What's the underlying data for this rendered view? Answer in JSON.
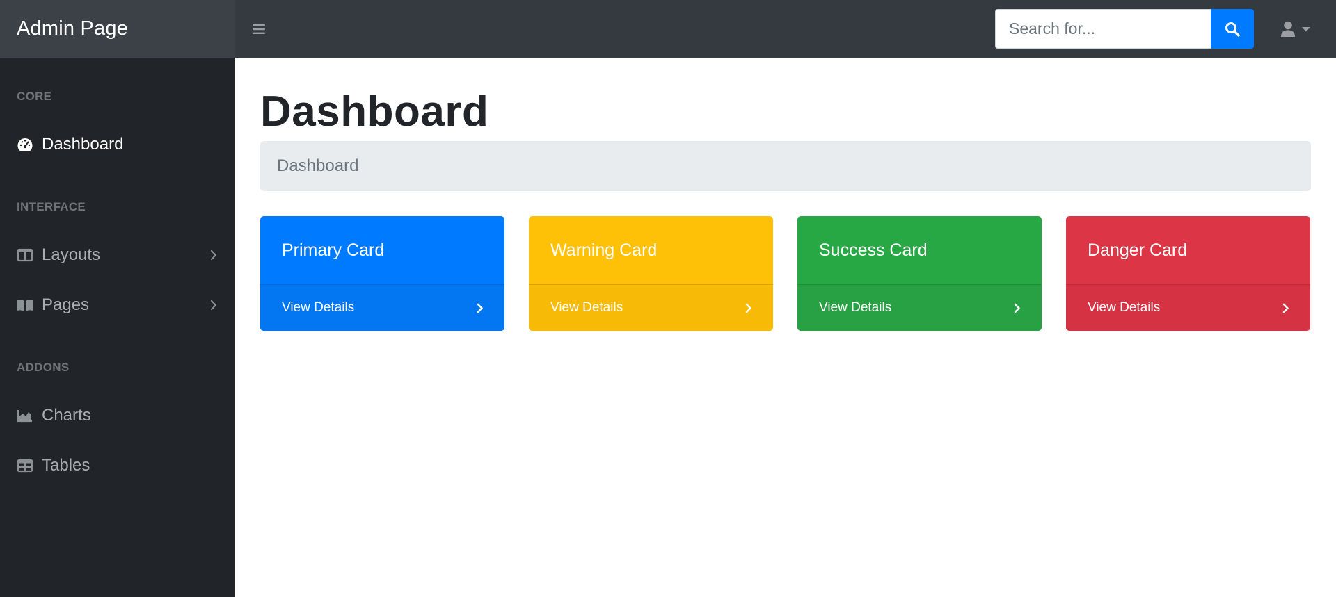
{
  "navbar": {
    "brand": "Admin Page",
    "search": {
      "placeholder": "Search for..."
    }
  },
  "sidebar": {
    "sections": [
      {
        "heading": "CORE"
      },
      {
        "heading": "INTERFACE"
      },
      {
        "heading": "ADDONS"
      }
    ],
    "items": [
      {
        "label": "Dashboard",
        "icon": "tachometer-icon",
        "active": true
      },
      {
        "label": "Layouts",
        "icon": "columns-icon",
        "has_submenu": true
      },
      {
        "label": "Pages",
        "icon": "book-open-icon",
        "has_submenu": true
      },
      {
        "label": "Charts",
        "icon": "area-chart-icon"
      },
      {
        "label": "Tables",
        "icon": "table-icon"
      }
    ]
  },
  "main": {
    "title": "Dashboard",
    "breadcrumb": "Dashboard",
    "cards": [
      {
        "title": "Primary Card",
        "footer": "View Details",
        "color": "#007bff"
      },
      {
        "title": "Warning Card",
        "footer": "View Details",
        "color": "#ffc107"
      },
      {
        "title": "Success Card",
        "footer": "View Details",
        "color": "#28a745"
      },
      {
        "title": "Danger Card",
        "footer": "View Details",
        "color": "#dc3545"
      }
    ]
  },
  "colors": {
    "navbar": "#343a40",
    "sidebar": "#212529",
    "accent": "#007bff"
  }
}
